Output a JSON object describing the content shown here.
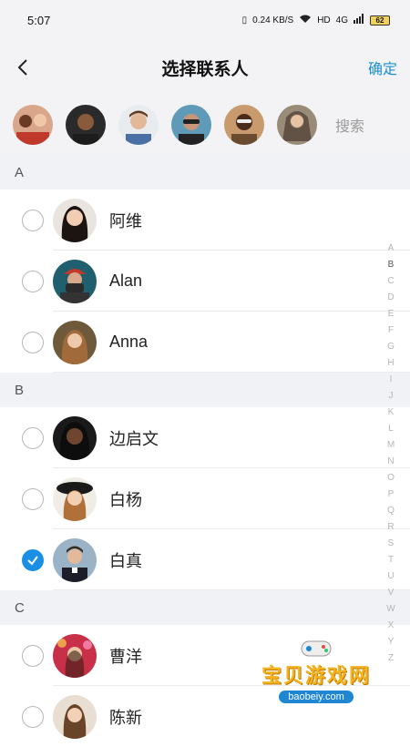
{
  "status": {
    "time": "5:07",
    "net_speed": "0.24 KB/S",
    "hd": "HD",
    "signal": "4G",
    "battery": "62"
  },
  "header": {
    "title": "选择联系人",
    "confirm_label": "确定"
  },
  "selected": {
    "search_label": "搜索"
  },
  "sections": [
    {
      "letter": "A",
      "contacts": [
        {
          "name": "阿维",
          "checked": false
        },
        {
          "name": "Alan",
          "checked": false
        },
        {
          "name": "Anna",
          "checked": false
        }
      ]
    },
    {
      "letter": "B",
      "contacts": [
        {
          "name": "边启文",
          "checked": false
        },
        {
          "name": "白杨",
          "checked": false
        },
        {
          "name": "白真",
          "checked": true
        }
      ]
    },
    {
      "letter": "C",
      "contacts": [
        {
          "name": "曹洋",
          "checked": false
        },
        {
          "name": "陈新",
          "checked": false
        }
      ]
    }
  ],
  "index_letters": [
    "A",
    "B",
    "C",
    "D",
    "E",
    "F",
    "G",
    "H",
    "I",
    "J",
    "K",
    "L",
    "M",
    "N",
    "O",
    "P",
    "Q",
    "R",
    "S",
    "T",
    "U",
    "V",
    "W",
    "X",
    "Y",
    "Z"
  ],
  "watermark": {
    "text": "宝贝游戏网",
    "url": "baobeiy.com"
  },
  "colors": {
    "accent": "#1a8fe3",
    "header_bg": "#f3f3f5"
  }
}
